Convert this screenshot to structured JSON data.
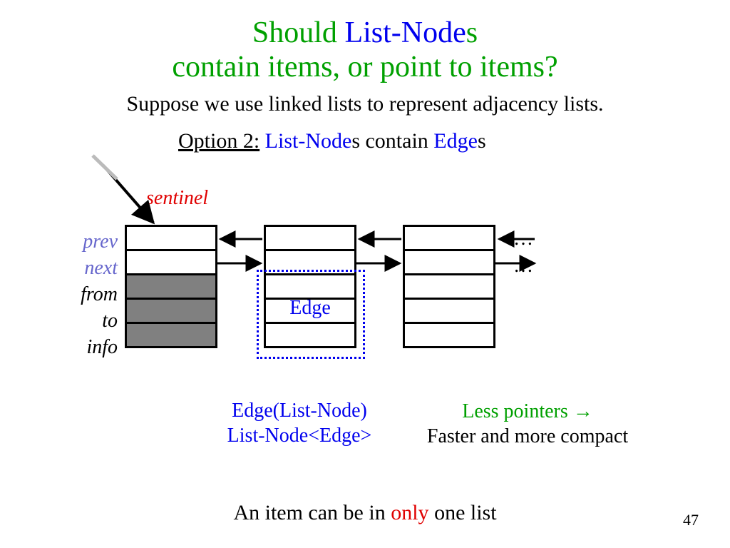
{
  "title": {
    "part1": "Should ",
    "part2": "List-Node",
    "part3": "s",
    "line2": "contain items, or point to items?"
  },
  "subtitle": "Suppose we use linked lists to represent adjacency lists.",
  "option2": {
    "label": "Option 2:",
    "ln": " List-Node",
    "s1": "s contain ",
    "edge": "Edge",
    "s2": "s"
  },
  "sentinel": "sentinel",
  "fields": {
    "prev": "prev",
    "next": "next",
    "from": "from",
    "to": "to",
    "info": "info"
  },
  "edge_box_label": "Edge",
  "ellipsis1": "…",
  "ellipsis2": "…",
  "caption_left_1": "Edge(List-Node)",
  "caption_left_2": "List-Node<Edge>",
  "caption_right_1a": "Less pointers ",
  "caption_right_1b": "→",
  "caption_right_2": "Faster and more compact",
  "bottom": {
    "a": "An item can be in ",
    "b": "only",
    "c": " one list"
  },
  "page": "47"
}
